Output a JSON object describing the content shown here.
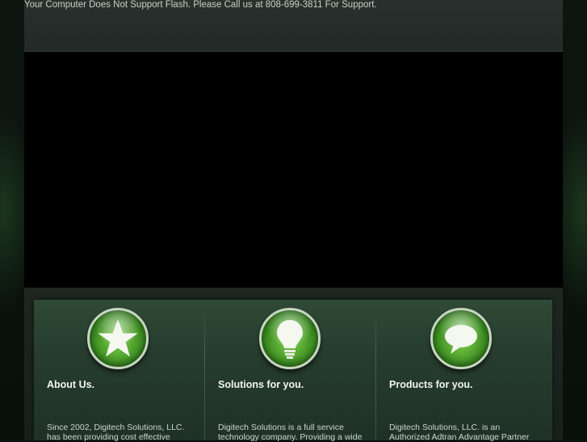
{
  "header": {
    "flash_notice": "Your Computer Does Not Support Flash. Please Call us at 808-699-3811 For Support."
  },
  "features": [
    {
      "icon": "star-icon",
      "title": "About Us.",
      "text": "Since 2002, Digitech Solutions, LLC. has been providing cost effective"
    },
    {
      "icon": "lightbulb-icon",
      "title": "Solutions for you.",
      "text": "Digitech Solutions is a full service technology company. Providing a wide"
    },
    {
      "icon": "speech-bubble-icon",
      "title": "Products for you.",
      "text": "Digitech Solutions, LLC. is an Authorized Adtran Advantage Partner"
    }
  ],
  "colors": {
    "accent_green": "#5fb033",
    "panel_green": "#2f4a36",
    "page_dark": "#0c140e"
  }
}
